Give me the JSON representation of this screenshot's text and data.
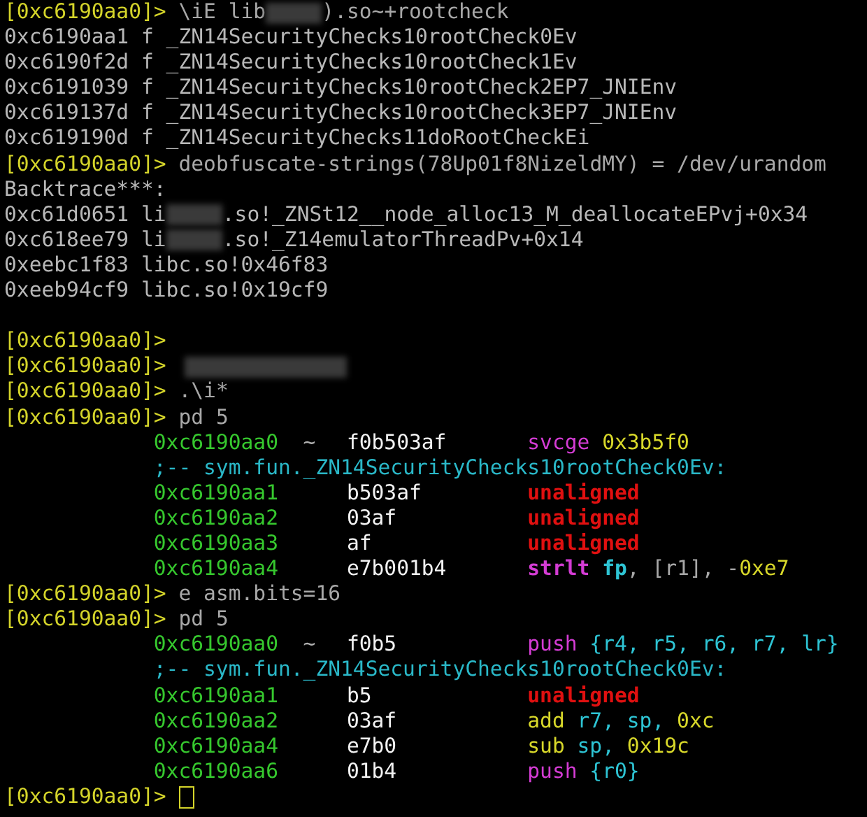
{
  "lines": [
    {
      "kind": "prompt",
      "prompt": "[0xc6190aa0]>",
      "parts": [
        {
          "kind": "text",
          "text": "\\iE lib"
        },
        {
          "kind": "redacted"
        },
        {
          "kind": "text",
          "text": ").so~+rootcheck"
        }
      ]
    },
    {
      "kind": "output",
      "text": "0xc6190aa1 f _ZN14SecurityChecks10rootCheck0Ev"
    },
    {
      "kind": "output",
      "text": "0xc6190f2d f _ZN14SecurityChecks10rootCheck1Ev"
    },
    {
      "kind": "output",
      "text": "0xc6191039 f _ZN14SecurityChecks10rootCheck2EP7_JNIEnv"
    },
    {
      "kind": "output",
      "text": "0xc619137d f _ZN14SecurityChecks10rootCheck3EP7_JNIEnv"
    },
    {
      "kind": "output",
      "text": "0xc619190d f _ZN14SecurityChecks11doRootCheckEi"
    },
    {
      "kind": "prompt",
      "prompt": "[0xc6190aa0]>",
      "parts": [
        {
          "kind": "text",
          "text": "deobfuscate-strings(78Up01f8NizeldMY) = /dev/urandom"
        }
      ]
    },
    {
      "kind": "output",
      "text": "Backtrace***:"
    },
    {
      "kind": "output-parts",
      "parts": [
        {
          "kind": "text",
          "text": "0xc61d0651 li"
        },
        {
          "kind": "redacted"
        },
        {
          "kind": "text",
          "text": ".so!_ZNSt12__node_alloc13_M_deallocateEPvj+0x34"
        }
      ]
    },
    {
      "kind": "output-parts",
      "parts": [
        {
          "kind": "text",
          "text": "0xc618ee79 li"
        },
        {
          "kind": "redacted"
        },
        {
          "kind": "text",
          "text": ".so!_Z14emulatorThreadPv+0x14"
        }
      ]
    },
    {
      "kind": "output",
      "text": "0xeebc1f83 libc.so!0x46f83"
    },
    {
      "kind": "output",
      "text": "0xeeb94cf9 libc.so!0x19cf9"
    },
    {
      "kind": "blank"
    },
    {
      "kind": "prompt",
      "prompt": "[0xc6190aa0]>"
    },
    {
      "kind": "prompt",
      "prompt": "[0xc6190aa0]>",
      "parts": [
        {
          "kind": "redacted"
        }
      ]
    },
    {
      "kind": "prompt",
      "prompt": "[0xc6190aa0]>",
      "parts": [
        {
          "kind": "text",
          "text": ".\\i*"
        }
      ]
    },
    {
      "kind": "prompt",
      "prompt": "[0xc6190aa0]>",
      "parts": [
        {
          "kind": "text",
          "text": "pd 5"
        }
      ]
    },
    {
      "kind": "asm",
      "address": "0xc6190aa0",
      "marker": "~",
      "bytes": "f0b503af",
      "tokens": [
        {
          "kind": "magenta",
          "bold": false,
          "text": "svcge "
        },
        {
          "kind": "yellow",
          "bold": false,
          "text": "0x3b5f0"
        }
      ]
    },
    {
      "kind": "label",
      "text": ";-- sym.fun._ZN14SecurityChecks10rootCheck0Ev:"
    },
    {
      "kind": "asm",
      "address": "0xc6190aa1",
      "bytes": "b503af",
      "tokens": [
        {
          "kind": "red",
          "bold": true,
          "text": "unaligned"
        }
      ]
    },
    {
      "kind": "asm",
      "address": "0xc6190aa2",
      "bytes": "03af",
      "tokens": [
        {
          "kind": "red",
          "bold": true,
          "text": "unaligned"
        }
      ]
    },
    {
      "kind": "asm",
      "address": "0xc6190aa3",
      "bytes": "af",
      "tokens": [
        {
          "kind": "red",
          "bold": true,
          "text": "unaligned"
        }
      ]
    },
    {
      "kind": "asm",
      "address": "0xc6190aa4",
      "bytes": "e7b001b4",
      "tokens": [
        {
          "kind": "magenta",
          "bold": true,
          "text": "strlt "
        },
        {
          "kind": "cyan",
          "bold": true,
          "text": "fp"
        },
        {
          "kind": "grey",
          "bold": false,
          "text": ", [r1], -"
        },
        {
          "kind": "yellow",
          "bold": false,
          "text": "0xe7"
        }
      ]
    },
    {
      "kind": "prompt",
      "prompt": "[0xc6190aa0]>",
      "parts": [
        {
          "kind": "text",
          "text": "e asm.bits=16"
        }
      ]
    },
    {
      "kind": "prompt",
      "prompt": "[0xc6190aa0]>",
      "parts": [
        {
          "kind": "text",
          "text": "pd 5"
        }
      ]
    },
    {
      "kind": "asm",
      "address": "0xc6190aa0",
      "marker": "~",
      "bytes": "f0b5",
      "tokens": [
        {
          "kind": "magenta",
          "bold": false,
          "text": "push "
        },
        {
          "kind": "cyan",
          "bold": false,
          "text": "{r4, r5, r6, r7, lr}"
        }
      ]
    },
    {
      "kind": "label",
      "text": ";-- sym.fun._ZN14SecurityChecks10rootCheck0Ev:"
    },
    {
      "kind": "asm",
      "address": "0xc6190aa1",
      "bytes": "b5",
      "tokens": [
        {
          "kind": "red",
          "bold": true,
          "text": "unaligned"
        }
      ]
    },
    {
      "kind": "asm",
      "address": "0xc6190aa2",
      "bytes": "03af",
      "tokens": [
        {
          "kind": "yellow",
          "bold": false,
          "text": "add "
        },
        {
          "kind": "cyan",
          "bold": false,
          "text": "r7, sp, "
        },
        {
          "kind": "yellow",
          "bold": false,
          "text": "0xc"
        }
      ]
    },
    {
      "kind": "asm",
      "address": "0xc6190aa4",
      "bytes": "e7b0",
      "tokens": [
        {
          "kind": "yellow",
          "bold": false,
          "text": "sub "
        },
        {
          "kind": "cyan",
          "bold": false,
          "text": "sp, "
        },
        {
          "kind": "yellow",
          "bold": false,
          "text": "0x19c"
        }
      ]
    },
    {
      "kind": "asm",
      "address": "0xc6190aa6",
      "bytes": "01b4",
      "tokens": [
        {
          "kind": "magenta",
          "bold": false,
          "text": "push "
        },
        {
          "kind": "cyan",
          "bold": false,
          "text": "{r0}"
        }
      ]
    },
    {
      "kind": "prompt",
      "prompt": "[0xc6190aa0]>",
      "cursor": true
    }
  ]
}
